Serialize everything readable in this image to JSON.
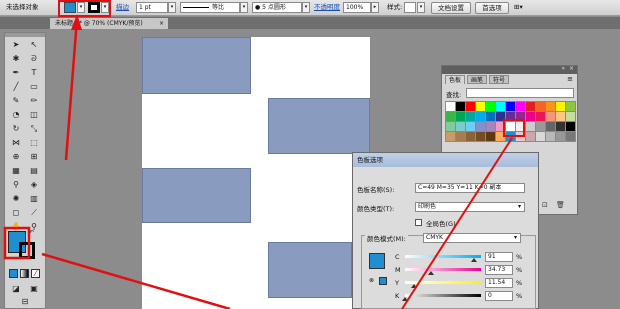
{
  "colors": {
    "blue_fill": "#1f8fd0",
    "rect_fill": "#8a9bc0",
    "annotation_red": "#e01010"
  },
  "control_bar": {
    "selection_label": "未选择对象",
    "stroke_label": "描边",
    "stroke_weight": "1 pt",
    "stroke_profile": "等比",
    "brush": "5 点圆形",
    "opacity_label": "不透明度",
    "opacity_value": "100%",
    "style_label": "样式:",
    "doc_setup_button": "文档设置",
    "prefs_button": "首选项"
  },
  "document_tab": {
    "title": "未标题-2* @ 70% (CMYK/预览)",
    "close": "×"
  },
  "swatches_panel": {
    "tabs": [
      "色板",
      "画笔",
      "符号"
    ],
    "search_label": "查找:",
    "swatch_colors": [
      "#ffffff",
      "#000000",
      "#ff0000",
      "#ffff00",
      "#00ff00",
      "#00ffff",
      "#0000ff",
      "#ff00ff",
      "#e21f26",
      "#f26522",
      "#f7941d",
      "#fff200",
      "#8dc63f",
      "#39b54a",
      "#00a651",
      "#00a99d",
      "#00aeef",
      "#0072bc",
      "#2e3192",
      "#662d91",
      "#92278f",
      "#ec008c",
      "#ed145b",
      "#f69679",
      "#fdc689",
      "#c4df9b",
      "#82ca9c",
      "#7accc8",
      "#6dcff6",
      "#8393ca",
      "#a187be",
      "#f49ac1",
      "#ffffff",
      "#eeeeee",
      "#cccccc",
      "#999999",
      "#666666",
      "#333333",
      "#000000",
      "#c69c6d",
      "#a67c52",
      "#8c6239",
      "#754c24",
      "#603913",
      "#fbaf5d",
      "#1f8fd0",
      "#e8c8c8",
      "#c8a8a8",
      "#d8d8d8",
      "#b8b8b8",
      "#989898",
      "#787878"
    ]
  },
  "dialog": {
    "title": "色板选项",
    "name_label": "色板名称(S):",
    "name_value": "C=49 M=35 Y=11 K=0 副本",
    "type_label": "颜色类型(T):",
    "type_value": "印刷色",
    "global_label": "全局色(G)",
    "mode_label": "颜色模式(M):",
    "mode_value": "CMYK",
    "channels": [
      {
        "label": "C",
        "value": "91",
        "unit": "%",
        "level": 0.91
      },
      {
        "label": "M",
        "value": "34.73",
        "unit": "%",
        "level": 0.347
      },
      {
        "label": "Y",
        "value": "11.54",
        "unit": "%",
        "level": 0.115
      },
      {
        "label": "K",
        "value": "0",
        "unit": "%",
        "level": 0.0
      }
    ]
  }
}
